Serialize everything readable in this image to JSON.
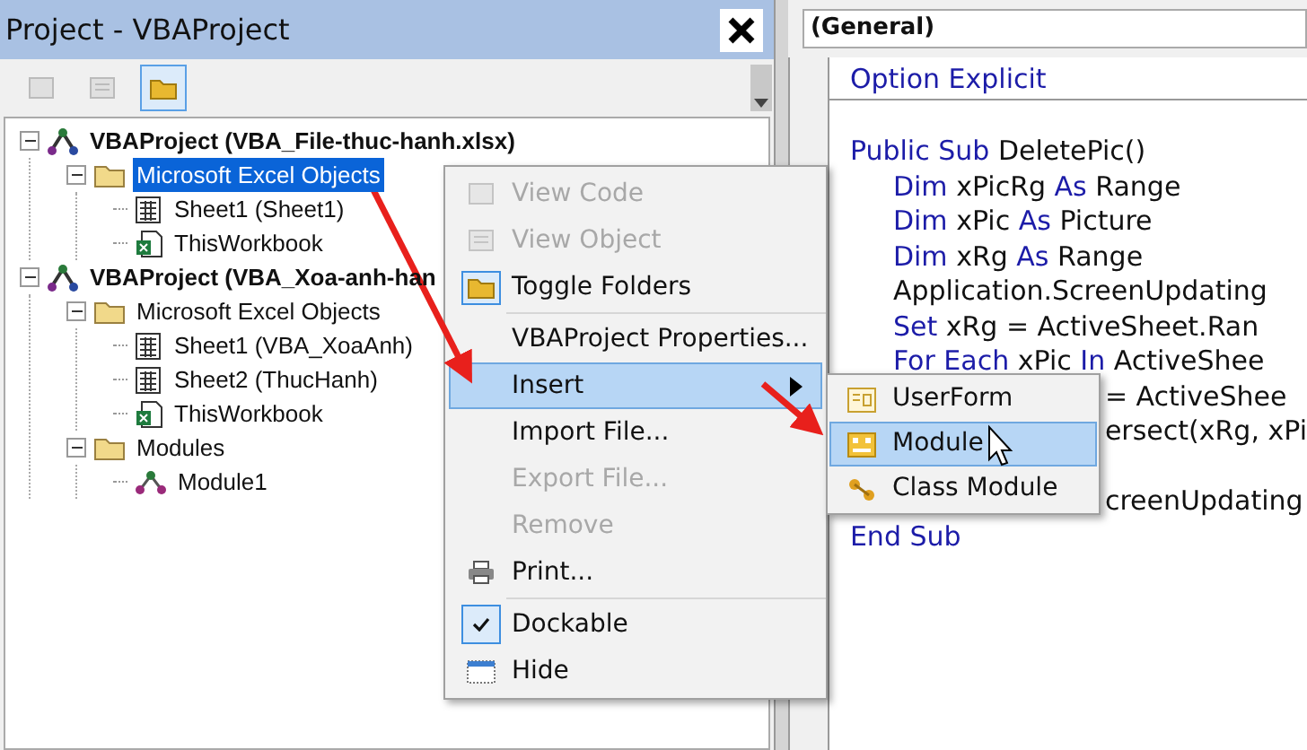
{
  "project_panel": {
    "title": "Project - VBAProject",
    "toolbar": [
      {
        "kind": "view-code",
        "selected": false
      },
      {
        "kind": "view-object",
        "selected": false
      },
      {
        "kind": "toggle-folders",
        "selected": true
      }
    ],
    "tree": [
      {
        "label": "VBAProject (VBA_File-thuc-hanh.xlsx)",
        "kind": "project",
        "expanded": true,
        "selected": false,
        "children": [
          {
            "label": "Microsoft Excel Objects",
            "kind": "folder",
            "expanded": true,
            "selected": true,
            "children": [
              {
                "label": "Sheet1 (Sheet1)",
                "kind": "sheet",
                "selected": false
              },
              {
                "label": "ThisWorkbook",
                "kind": "workbook",
                "selected": false
              }
            ]
          }
        ]
      },
      {
        "label": "VBAProject (VBA_Xoa-anh-han",
        "kind": "project",
        "expanded": true,
        "selected": false,
        "children": [
          {
            "label": "Microsoft Excel Objects",
            "kind": "folder",
            "expanded": true,
            "selected": false,
            "children": [
              {
                "label": "Sheet1 (VBA_XoaAnh)",
                "kind": "sheet",
                "selected": false
              },
              {
                "label": "Sheet2 (ThucHanh)",
                "kind": "sheet",
                "selected": false
              },
              {
                "label": "ThisWorkbook",
                "kind": "workbook",
                "selected": false
              }
            ]
          },
          {
            "label": "Modules",
            "kind": "folder",
            "expanded": true,
            "selected": false,
            "children": [
              {
                "label": "Module1",
                "kind": "module",
                "selected": false
              }
            ]
          }
        ]
      }
    ]
  },
  "code_window": {
    "object_dropdown": "(General)",
    "lines": [
      {
        "kind": "top",
        "tokens": [
          {
            "text": "Option Explicit",
            "kind": "keyword"
          }
        ]
      },
      {
        "kind": "blank"
      },
      {
        "kind": "top",
        "tokens": [
          {
            "text": "Public Sub",
            "kind": "keyword"
          },
          {
            "text": " DeletePic()",
            "kind": "plain"
          }
        ]
      },
      {
        "kind": "body",
        "tokens": [
          {
            "text": "Dim",
            "kind": "keyword"
          },
          {
            "text": " xPicRg ",
            "kind": "plain"
          },
          {
            "text": "As",
            "kind": "keyword"
          },
          {
            "text": " Range",
            "kind": "plain"
          }
        ]
      },
      {
        "kind": "body",
        "tokens": [
          {
            "text": "Dim",
            "kind": "keyword"
          },
          {
            "text": " xPic ",
            "kind": "plain"
          },
          {
            "text": "As",
            "kind": "keyword"
          },
          {
            "text": " Picture",
            "kind": "plain"
          }
        ]
      },
      {
        "kind": "body",
        "tokens": [
          {
            "text": "Dim",
            "kind": "keyword"
          },
          {
            "text": " xRg ",
            "kind": "plain"
          },
          {
            "text": "As",
            "kind": "keyword"
          },
          {
            "text": " Range",
            "kind": "plain"
          }
        ]
      },
      {
        "kind": "body",
        "tokens": [
          {
            "text": "Application.ScreenUpdating",
            "kind": "plain"
          }
        ]
      },
      {
        "kind": "body",
        "tokens": [
          {
            "text": "Set",
            "kind": "keyword"
          },
          {
            "text": " xRg = ActiveSheet.Ran",
            "kind": "plain"
          }
        ]
      },
      {
        "kind": "body",
        "tokens": [
          {
            "text": "For Each",
            "kind": "keyword"
          },
          {
            "text": " xPic ",
            "kind": "plain"
          },
          {
            "text": "In",
            "kind": "keyword"
          },
          {
            "text": " ActiveShee",
            "kind": "plain"
          }
        ]
      },
      {
        "kind": "covered",
        "tokens": [
          {
            "text": "= ActiveShee",
            "kind": "plain"
          }
        ]
      },
      {
        "kind": "covered",
        "tokens": [
          {
            "text": "ersect(xRg, xPi",
            "kind": "plain"
          }
        ]
      },
      {
        "kind": "blank"
      },
      {
        "kind": "covered",
        "tokens": [
          {
            "text": "creenUpdating",
            "kind": "plain"
          }
        ]
      },
      {
        "kind": "top",
        "tokens": [
          {
            "text": "End Sub",
            "kind": "keyword"
          }
        ]
      }
    ]
  },
  "context_menu": {
    "items": [
      {
        "kind": "item",
        "label": "View Code",
        "disabled": true,
        "selected": false
      },
      {
        "kind": "item",
        "label": "View Object",
        "disabled": true,
        "selected": false
      },
      {
        "kind": "item",
        "label": "Toggle Folders",
        "disabled": false,
        "selected": false
      },
      {
        "kind": "separator"
      },
      {
        "kind": "item",
        "label": "VBAProject Properties...",
        "disabled": false,
        "selected": false
      },
      {
        "kind": "submenu",
        "label": "Insert",
        "disabled": false,
        "selected": true
      },
      {
        "kind": "item",
        "label": "Import File...",
        "disabled": false,
        "selected": false
      },
      {
        "kind": "item",
        "label": "Export File...",
        "disabled": true,
        "selected": false
      },
      {
        "kind": "item",
        "label": "Remove",
        "disabled": true,
        "selected": false
      },
      {
        "kind": "item",
        "label": "Print...",
        "disabled": false,
        "selected": false
      },
      {
        "kind": "separator"
      },
      {
        "kind": "check",
        "label": "Dockable",
        "checked": true,
        "disabled": false,
        "selected": false
      },
      {
        "kind": "item",
        "label": "Hide",
        "disabled": false,
        "selected": false
      }
    ]
  },
  "insert_submenu": {
    "items": [
      {
        "label": "UserForm",
        "selected": false
      },
      {
        "label": "Module",
        "selected": true
      },
      {
        "label": "Class Module",
        "selected": false
      }
    ]
  }
}
